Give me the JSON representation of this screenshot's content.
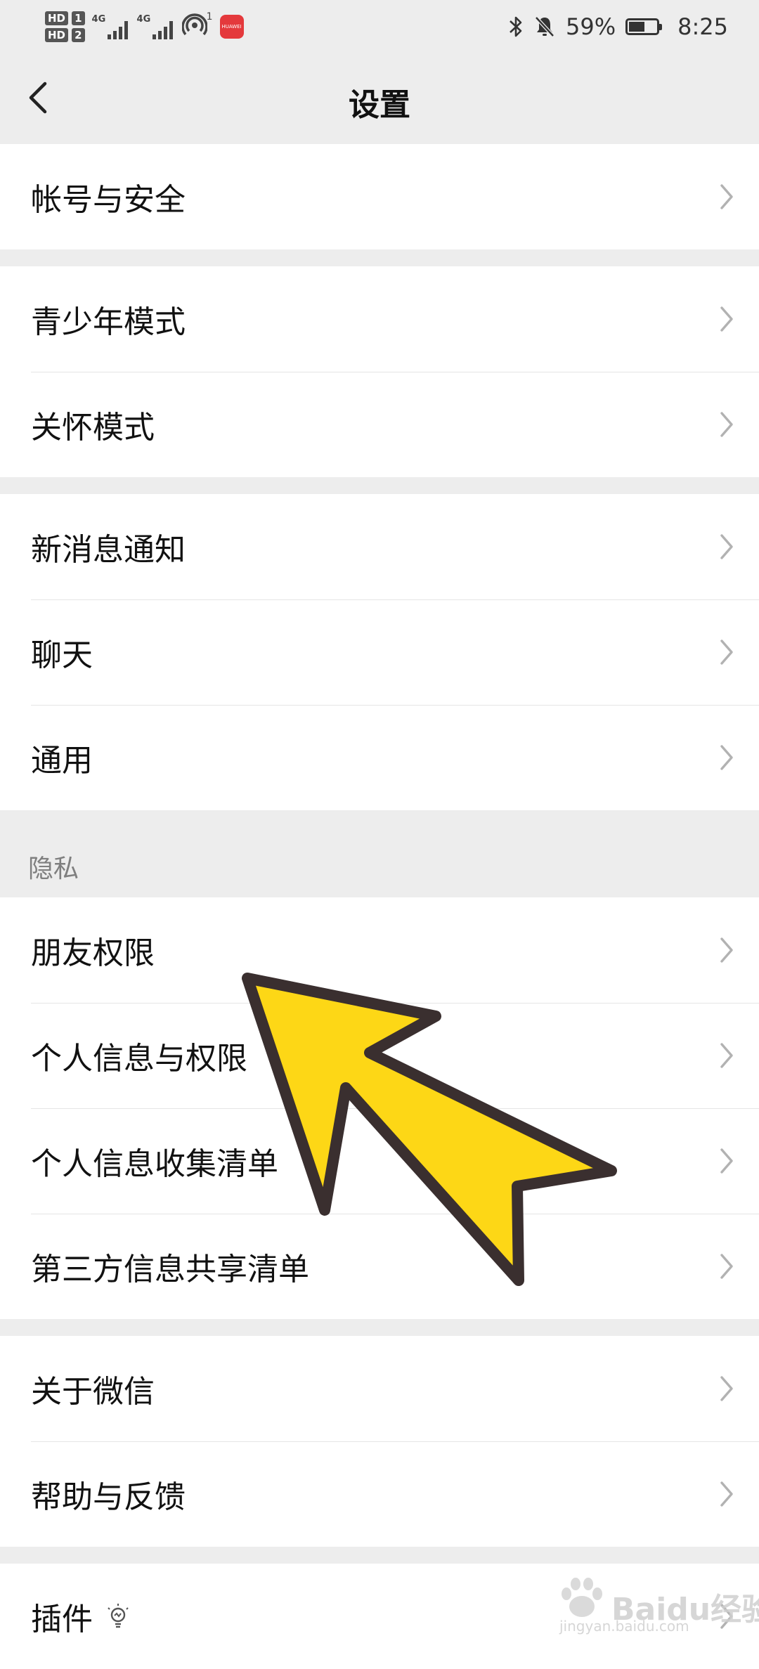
{
  "status_bar": {
    "sim1_label": "HD",
    "sim1_num": "1",
    "sim2_label": "HD",
    "sim2_num": "2",
    "net1": "4G",
    "net2": "4G",
    "hotspot_count": "1",
    "app_badge": "HUAWEI",
    "battery_percent": "59%",
    "battery_level": 0.59,
    "time": "8:25"
  },
  "header": {
    "title": "设置"
  },
  "groups": [
    {
      "items": [
        {
          "label": "帐号与安全"
        }
      ]
    },
    {
      "items": [
        {
          "label": "青少年模式"
        },
        {
          "label": "关怀模式"
        }
      ]
    },
    {
      "items": [
        {
          "label": "新消息通知"
        },
        {
          "label": "聊天"
        },
        {
          "label": "通用"
        }
      ]
    },
    {
      "section_title": "隐私",
      "items": [
        {
          "label": "朋友权限"
        },
        {
          "label": "个人信息与权限"
        },
        {
          "label": "个人信息收集清单"
        },
        {
          "label": "第三方信息共享清单"
        }
      ]
    },
    {
      "items": [
        {
          "label": "关于微信"
        },
        {
          "label": "帮助与反馈"
        }
      ]
    },
    {
      "items": [
        {
          "label": "插件",
          "icon": "lightbulb-icon"
        }
      ]
    }
  ],
  "watermark": {
    "brand": "Baidu经验",
    "url": "jingyan.baidu.com"
  },
  "colors": {
    "background": "#ededed",
    "row": "#ffffff",
    "arrow_fill": "#fdd716",
    "arrow_stroke": "#3a2f2f"
  }
}
